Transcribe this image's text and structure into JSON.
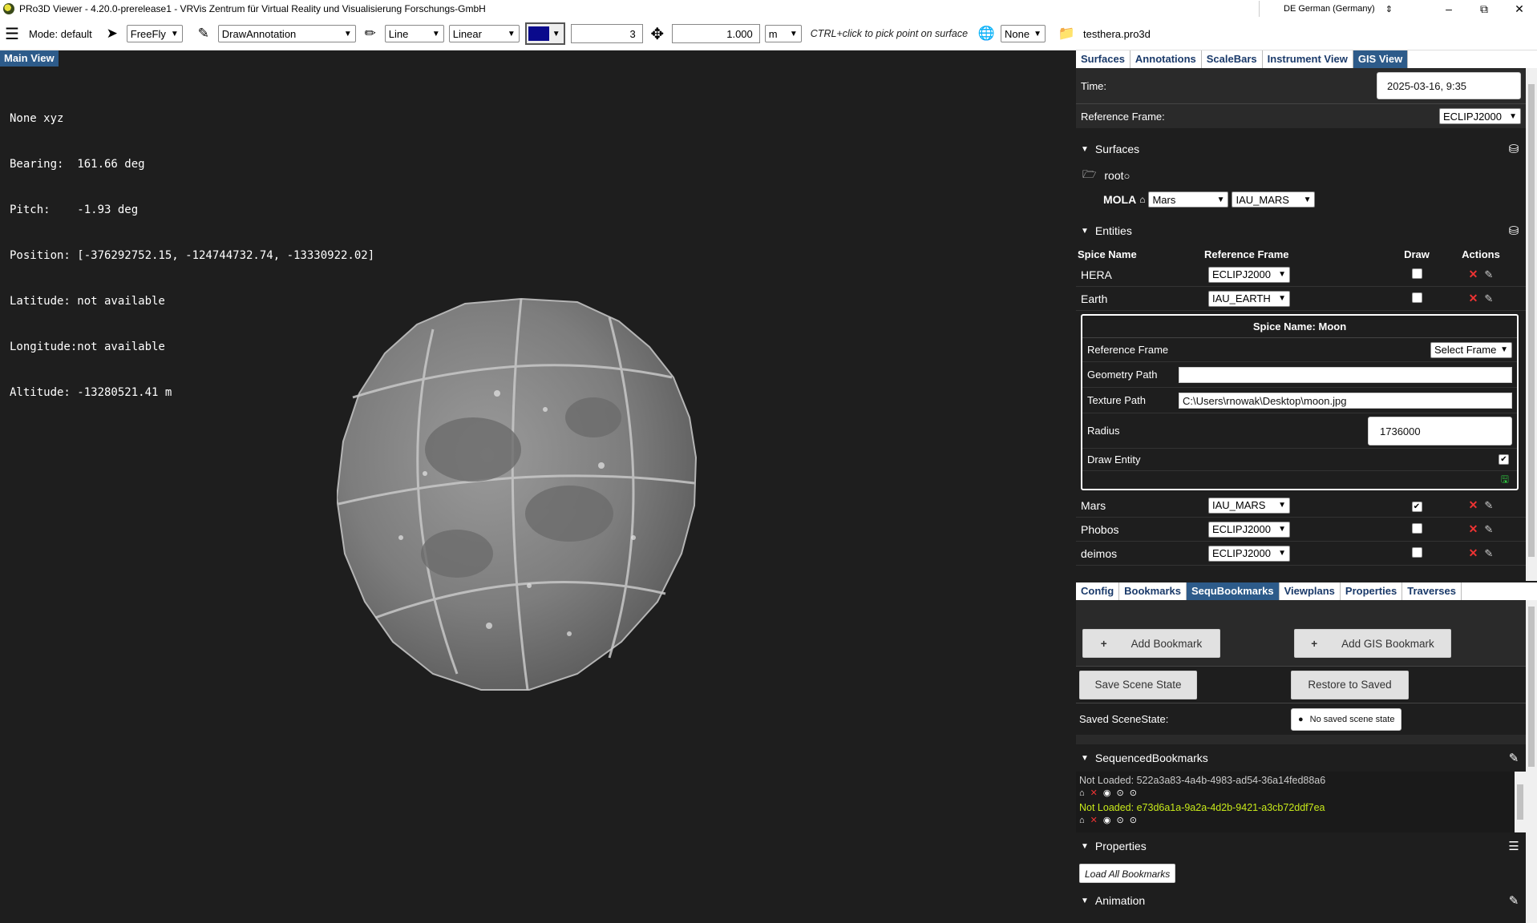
{
  "window": {
    "title": "PRo3D Viewer - 4.20.0-prerelease1 - VRVis Zentrum für Virtual Reality und Visualisierung Forschungs-GmbH",
    "language": "DE German (Germany)",
    "minimize": "–",
    "restore": "⧉",
    "close": "✕"
  },
  "toolbar": {
    "menu_icon": "hamburger-icon",
    "mode_label": "Mode: default",
    "nav_mode": "FreeFly",
    "interaction": "DrawAnnotation",
    "geometry": "Line",
    "projection": "Linear",
    "color": "#0a0a8c",
    "thickness": "3",
    "offset": "1.000",
    "unit": "m",
    "hint": "CTRL+click to pick point on surface",
    "semantic": "None",
    "scene_file": "testhera.pro3d"
  },
  "main_view": {
    "tab_label": "Main View",
    "overlay_lines": [
      "None xyz",
      "Bearing:  161.66 deg",
      "Pitch:    -1.93 deg",
      "Position: [-376292752.15, -124744732.74, -13330922.02]",
      "Latitude: not available",
      "Longitude:not available",
      "Altitude: -13280521.41 m"
    ]
  },
  "top_tabs": [
    "Surfaces",
    "Annotations",
    "ScaleBars",
    "Instrument View",
    "GIS View"
  ],
  "gis": {
    "time_label": "Time:",
    "time_value": "2025-03-16, 9:35",
    "ref_frame_label": "Reference Frame:",
    "ref_frame_value": "ECLIPJ2000",
    "surfaces_title": "Surfaces",
    "root_label": "root",
    "mola_label": "MOLA",
    "mola_body": "Mars",
    "mola_frame": "IAU_MARS",
    "entities_title": "Entities",
    "columns": [
      "Spice Name",
      "Reference Frame",
      "Draw",
      "Actions"
    ],
    "entities_top": [
      {
        "name": "HERA",
        "frame": "ECLIPJ2000",
        "draw": false
      },
      {
        "name": "Earth",
        "frame": "IAU_EARTH",
        "draw": false
      }
    ],
    "moon_editor": {
      "title": "Spice Name: Moon",
      "ref_frame_label": "Reference Frame",
      "ref_frame_value": "Select Frame",
      "geometry_label": "Geometry Path",
      "geometry_value": "",
      "texture_label": "Texture Path",
      "texture_value": "C:\\Users\\rnowak\\Desktop\\moon.jpg",
      "radius_label": "Radius",
      "radius_value": "1736000",
      "draw_label": "Draw Entity",
      "draw_checked": true
    },
    "entities_bottom": [
      {
        "name": "Mars",
        "frame": "IAU_MARS",
        "draw": true
      },
      {
        "name": "Phobos",
        "frame": "ECLIPJ2000",
        "draw": false
      },
      {
        "name": "deimos",
        "frame": "ECLIPJ2000",
        "draw": false
      }
    ]
  },
  "bottom_tabs": [
    "Config",
    "Bookmarks",
    "SequBookmarks",
    "Viewplans",
    "Properties",
    "Traverses"
  ],
  "sequ": {
    "add_bookmark": "Add Bookmark",
    "add_gis_bookmark": "Add GIS Bookmark",
    "save_scene": "Save Scene State",
    "restore_saved": "Restore to Saved",
    "saved_label": "Saved SceneState:",
    "saved_value": "No saved scene state",
    "seq_title": "SequencedBookmarks",
    "bookmarks": [
      {
        "text": "Not Loaded: 522a3a83-4a4b-4983-ad54-36a14fed88a6",
        "color": "#cccccc"
      },
      {
        "text": "Not Loaded: e73d6a1a-9a2a-4d2b-9421-a3cb72ddf7ea",
        "color": "#c7e81a"
      }
    ],
    "properties_title": "Properties",
    "load_all": "Load All Bookmarks",
    "animation_title": "Animation"
  }
}
